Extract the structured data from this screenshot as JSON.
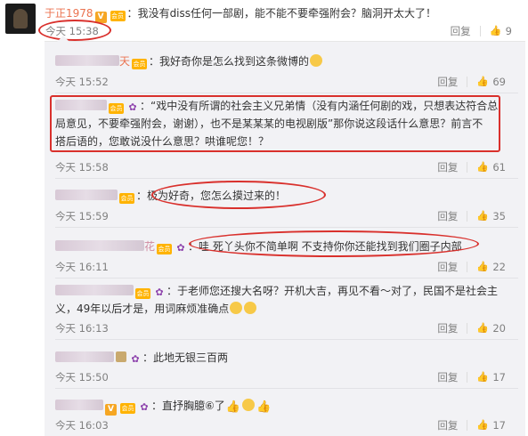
{
  "top_comment": {
    "username": "于正1978",
    "verified_badge": "V",
    "level_badge": "会员",
    "colon": "：",
    "text": "我没有diss任何一部剧，能不能不要牵强附会？脑洞开太大了！",
    "time": "今天 15:38",
    "reply_label": "回复",
    "like_count": "9"
  },
  "replies": [
    {
      "name_tail": "天",
      "text": "：我好奇你是怎么找到这条微博的",
      "time": "今天 15:52",
      "reply_label": "回复",
      "like_count": "69"
    },
    {
      "name_tail": "",
      "text_line1": "：“戏中没有所谓的社会主义兄弟情（没有内涵任何剧的戏，只想表达符合总",
      "text_line2": "局意见，不要牵强附会，谢谢），也不是某某某的电视剧版”那你说这段话什么意思？前言不",
      "text_line3": "搭后语的，您敢说没什么意思？哄谁呢您！？",
      "time": "今天 15:58",
      "reply_label": "回复",
      "like_count": "61"
    },
    {
      "name_tail": "",
      "text": "：极为好奇，您怎么摸过来的！",
      "time": "今天 15:59",
      "reply_label": "回复",
      "like_count": "35"
    },
    {
      "name_tail": "花",
      "text": "：哇 死丫头你不简单啊 不支持你你还能找到我们圈子内部",
      "time": "今天 16:11",
      "reply_label": "回复",
      "like_count": "22"
    },
    {
      "name_tail": "",
      "text_line1": "：于老师您还搜大名呀？开机大吉，再见不看～对了，民国不是社会主",
      "text_line2": "义，49年以后才是，用词麻烦准确点",
      "time": "今天 16:13",
      "reply_label": "回复",
      "like_count": "20"
    },
    {
      "name_tail": "",
      "text": "：此地无银三百两",
      "time": "今天 15:50",
      "reply_label": "回复",
      "like_count": "17"
    },
    {
      "name_tail": "",
      "text": "：直抒胸臆⑥了",
      "time": "今天 16:03",
      "reply_label": "回复",
      "like_count": "17"
    }
  ],
  "icons": {
    "like": "thumbs-up-icon",
    "flower": "flower-badge-icon",
    "emoji": "smiley-emoji-icon"
  },
  "colors": {
    "username": "#eb7350",
    "annotation": "#d9302c",
    "reply_bg": "#f2f2f5"
  }
}
